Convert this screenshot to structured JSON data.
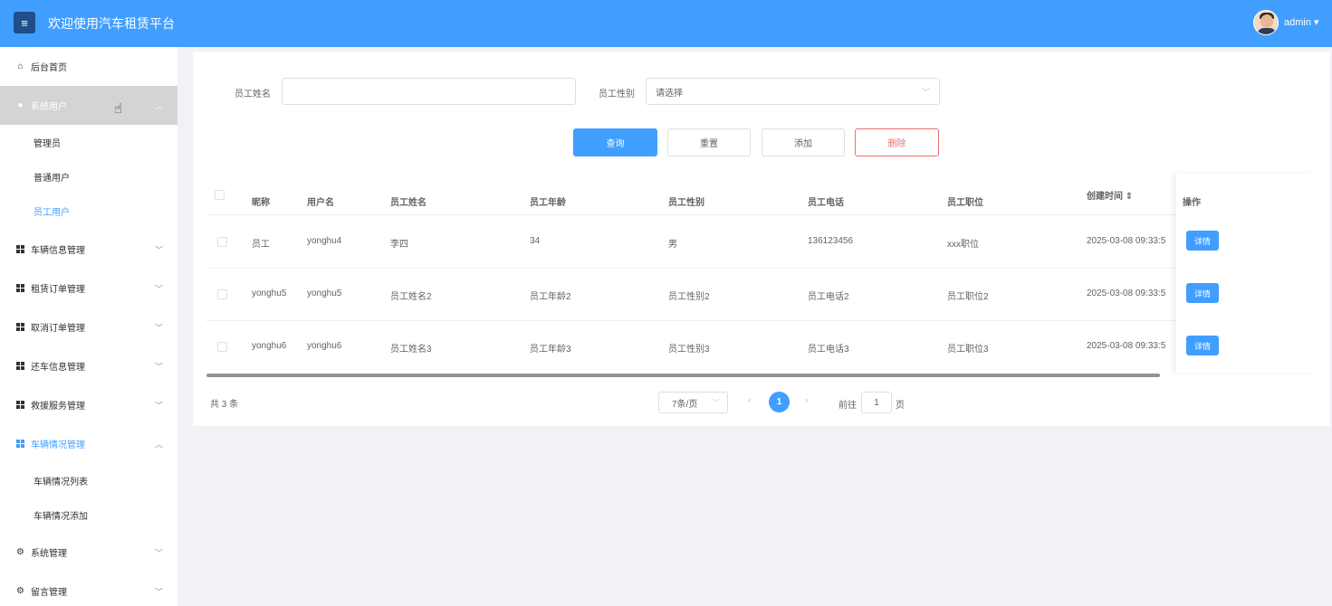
{
  "header": {
    "menu_icon": "hamburger-icon",
    "title": "欢迎使用汽车租赁平台",
    "user": "admin ▾"
  },
  "sidebar": {
    "home": "后台首页",
    "system_users": "系统用户",
    "system_users_children": [
      "管理员",
      "普通用户",
      "员工用户"
    ],
    "menus": [
      "车辆信息管理",
      "租赁订单管理",
      "取消订单管理",
      "还车信息管理",
      "救援服务管理",
      "车辆情况管理"
    ],
    "vehicle_status_children": [
      "车辆情况列表",
      "车辆情况添加"
    ],
    "system_mgmt": "系统管理",
    "message_mgmt": "留言管理"
  },
  "search": {
    "name_label": "员工姓名",
    "name_value": "",
    "gender_label": "员工性别",
    "gender_placeholder": "请选择"
  },
  "buttons": {
    "query": "查询",
    "reset": "重置",
    "add": "添加",
    "delete": "删除"
  },
  "table": {
    "headers": [
      "昵称",
      "用户名",
      "员工姓名",
      "员工年龄",
      "员工性别",
      "员工电话",
      "员工职位",
      "创建时间 ⇕",
      "操作"
    ],
    "rows": [
      [
        "员工",
        "yonghu4",
        "李四",
        "34",
        "男",
        "136123456",
        "xxx职位",
        "2025-03-08 09:33:5"
      ],
      [
        "yonghu5",
        "yonghu5",
        "员工姓名2",
        "员工年龄2",
        "员工性别2",
        "员工电话2",
        "员工职位2",
        "2025-03-08 09:33:5"
      ],
      [
        "yonghu6",
        "yonghu6",
        "员工姓名3",
        "员工年龄3",
        "员工性别3",
        "员工电话3",
        "员工职位3",
        "2025-03-08 09:33:5"
      ]
    ],
    "detail_label": "详情"
  },
  "pagination": {
    "total": "共 3 条",
    "page_size": "7条/页",
    "current": "1",
    "goto_prefix": "前往",
    "goto_value": "1",
    "goto_suffix": "页"
  }
}
